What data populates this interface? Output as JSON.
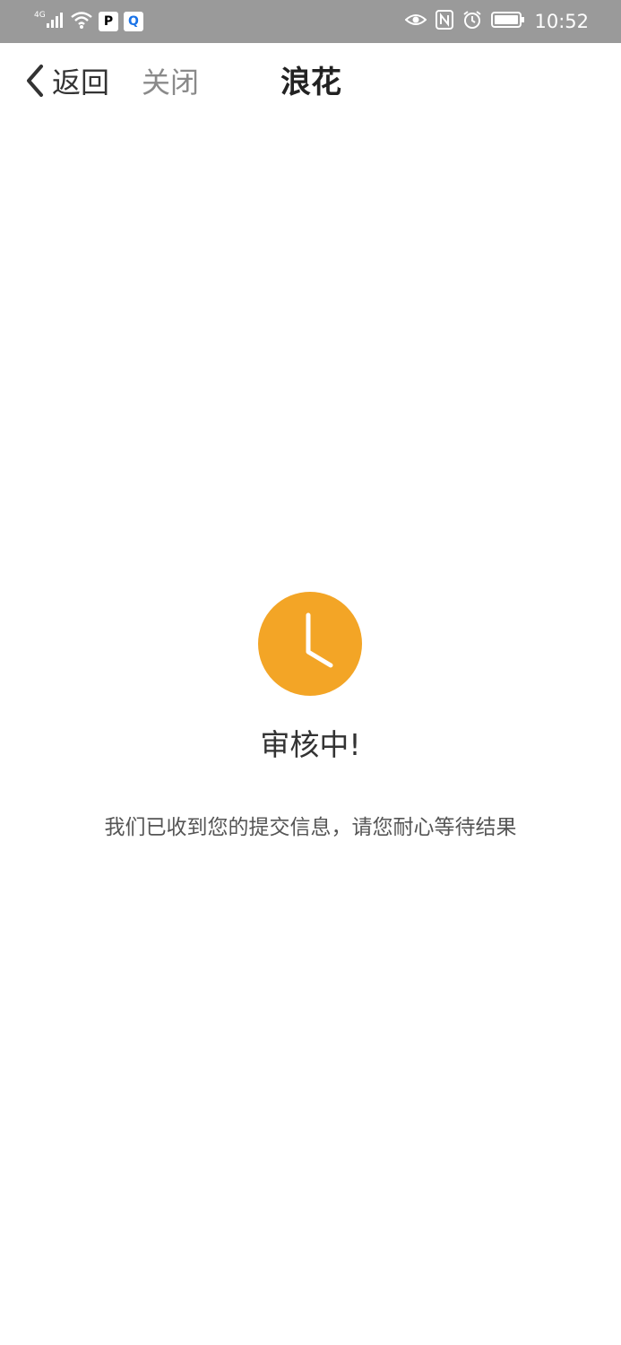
{
  "status_bar": {
    "network_type": "4G",
    "time": "10:52",
    "app_icons": [
      "p-app-icon",
      "q-app-icon"
    ],
    "icons": [
      "signal-icon",
      "wifi-icon",
      "eye-icon",
      "nfc-icon",
      "alarm-icon",
      "battery-icon"
    ]
  },
  "nav": {
    "back_label": "返回",
    "close_label": "关闭",
    "title": "浪花"
  },
  "main": {
    "status_title": "审核中!",
    "status_description": "我们已收到您的提交信息，请您耐心等待结果",
    "icon": "clock-icon",
    "accent_color": "#f3a526"
  }
}
